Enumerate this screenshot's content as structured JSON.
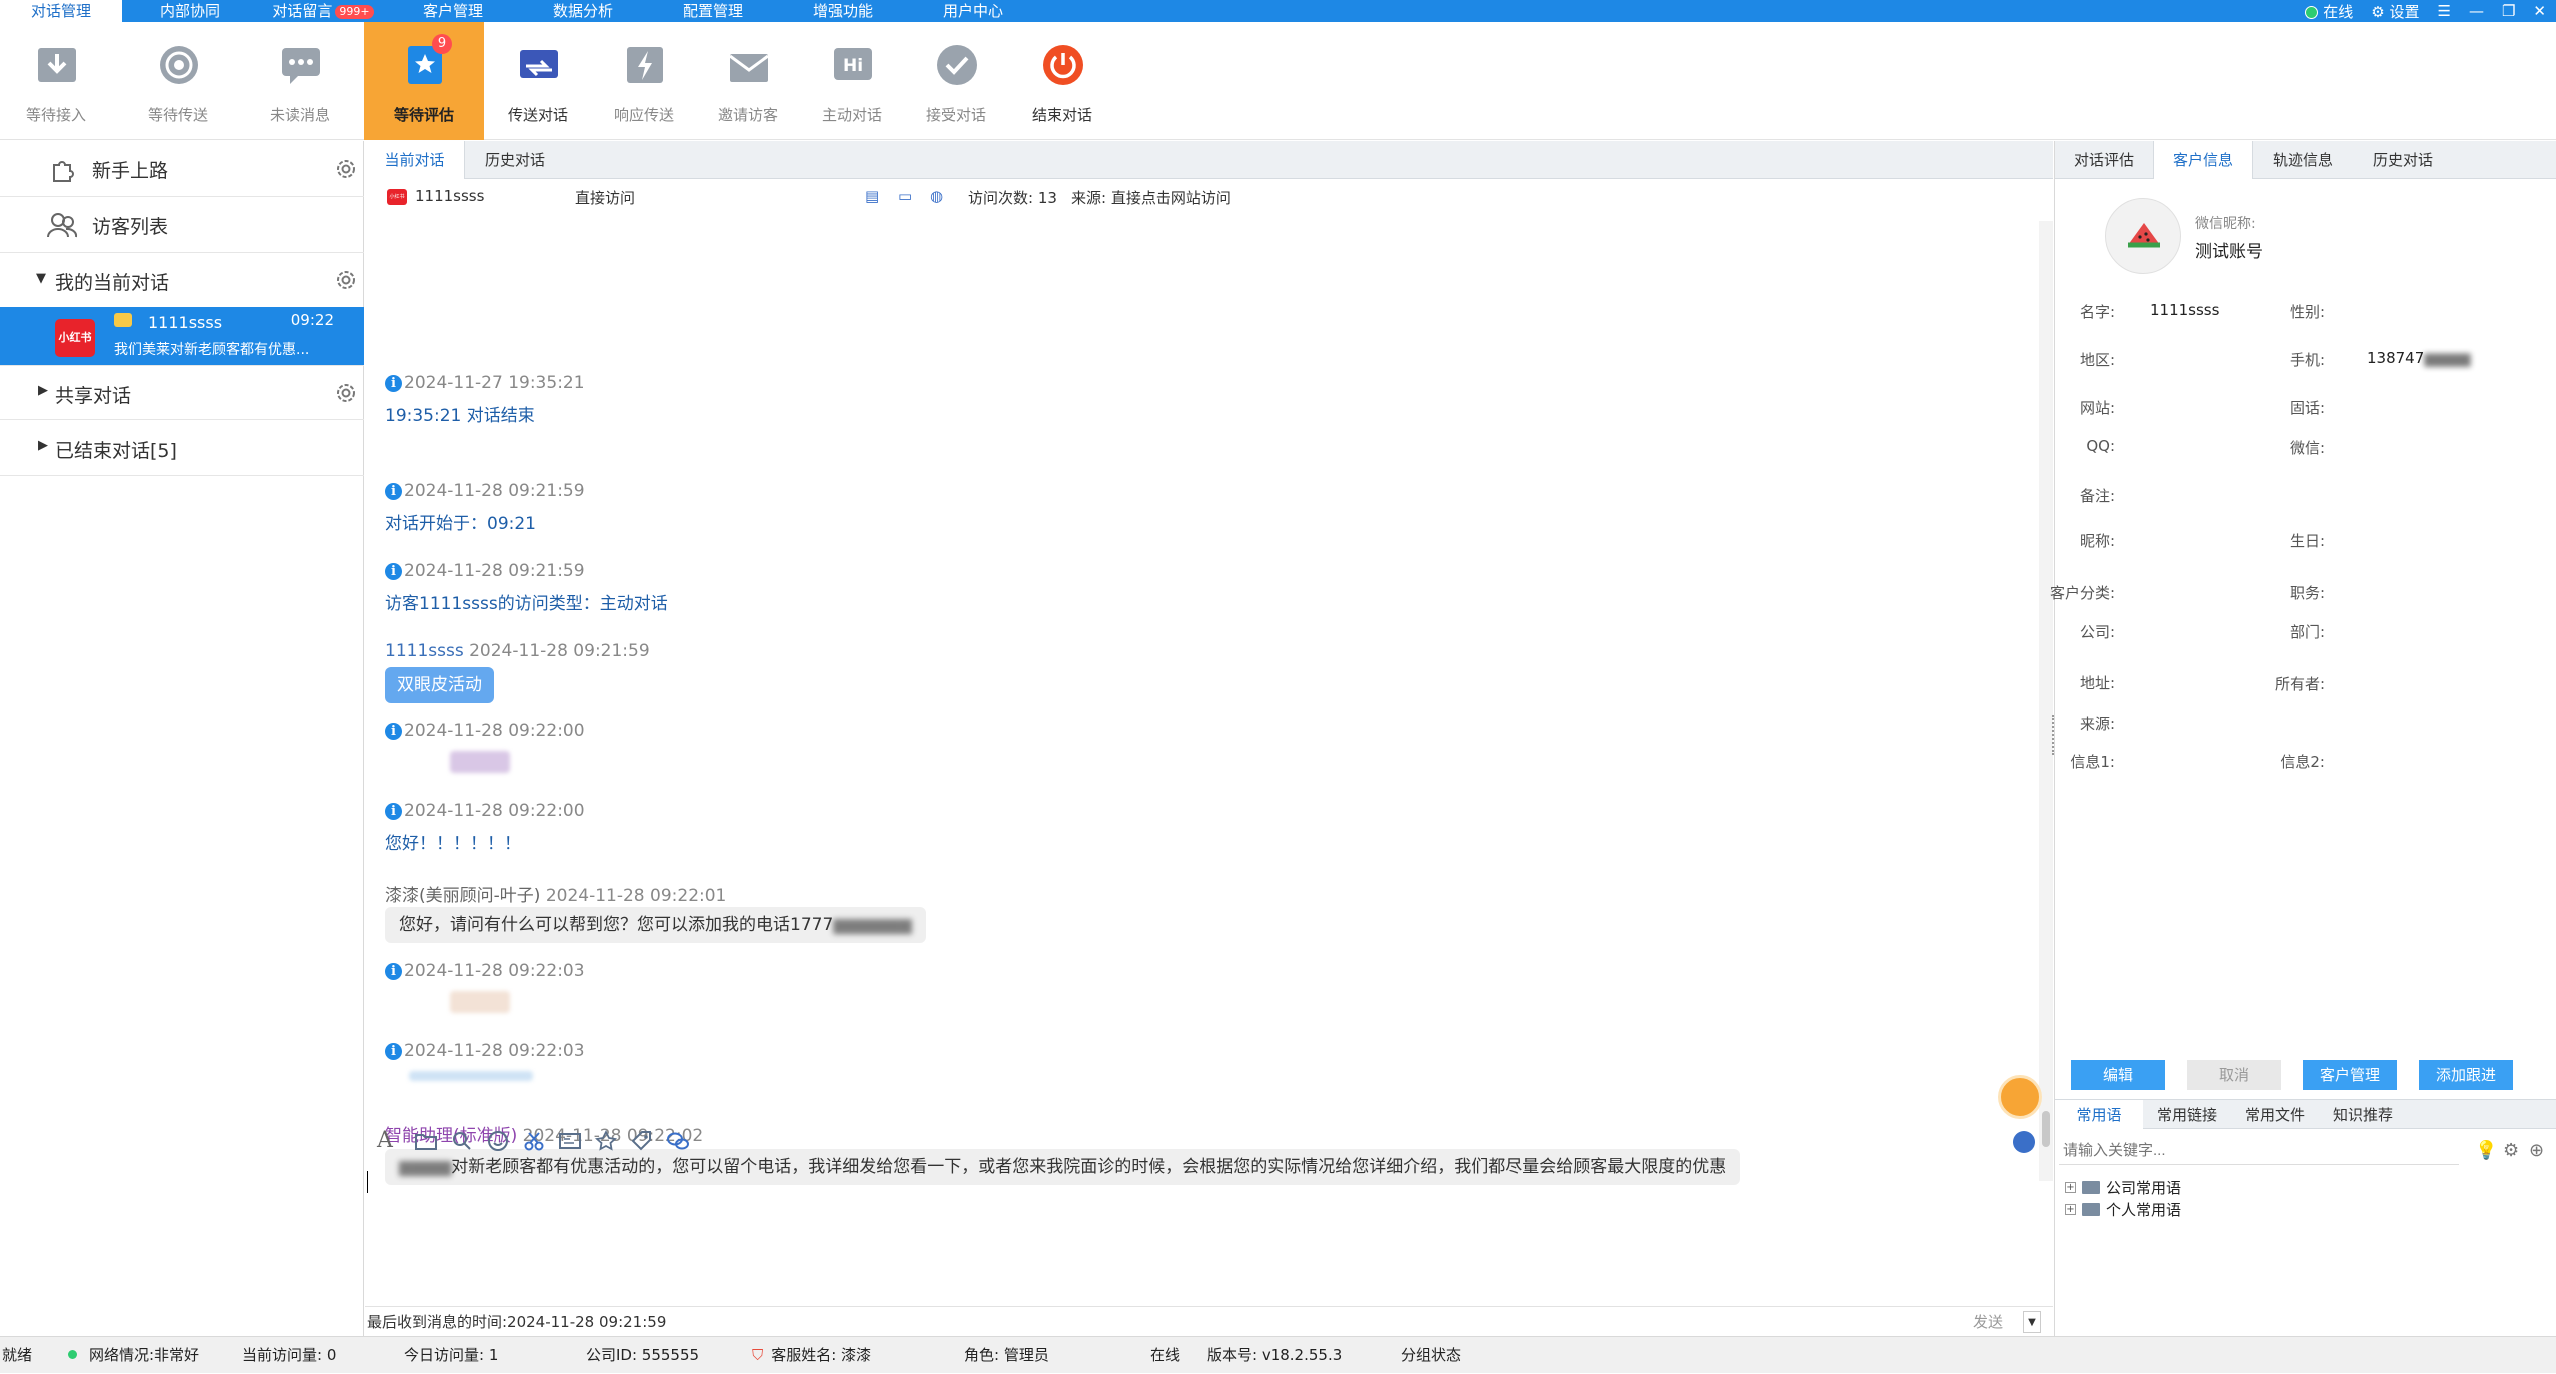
{
  "menu_tabs": [
    {
      "label": "对话管理",
      "active": true
    },
    {
      "label": "内部协同",
      "active": false
    },
    {
      "label": "对话留言",
      "badge": "999+",
      "active": false
    },
    {
      "label": "客户管理",
      "active": false
    },
    {
      "label": "数据分析",
      "active": false
    },
    {
      "label": "配置管理",
      "active": false
    },
    {
      "label": "增强功能",
      "active": false
    },
    {
      "label": "用户中心",
      "active": false
    }
  ],
  "top_right": {
    "status": "在线",
    "settings": "设置"
  },
  "toolbar": [
    {
      "label": "等待接入",
      "icon": "download-inbox-icon"
    },
    {
      "label": "等待传送",
      "icon": "broadcast-icon"
    },
    {
      "label": "未读消息",
      "icon": "chat-bubble-icon"
    },
    {
      "label": "等待评估",
      "icon": "star-badge-icon",
      "badge": "9",
      "active": true
    },
    {
      "label": "传送对话",
      "icon": "transfer-icon"
    },
    {
      "label": "响应传送",
      "icon": "lightning-icon"
    },
    {
      "label": "邀请访客",
      "icon": "envelope-icon"
    },
    {
      "label": "主动对话",
      "icon": "hi-icon"
    },
    {
      "label": "接受对话",
      "icon": "checkmark-icon"
    },
    {
      "label": "结束对话",
      "icon": "power-icon"
    }
  ],
  "sidebar": {
    "newbie": "新手上路",
    "visitor_list": "访客列表",
    "my_current": "我的当前对话",
    "conversation": {
      "source_tag": "小红书",
      "name": "1111ssss",
      "time": "09:22",
      "preview": "我们美莱对新老顾客都有优惠..."
    },
    "shared": "共享对话",
    "ended": "已结束对话[5]"
  },
  "center": {
    "tabs": [
      "当前对话",
      "历史对话"
    ],
    "visitor_source_tag": "小红书",
    "visitor_name": "1111ssss",
    "access_type": "直接访问",
    "visit_count": "访问次数: 13",
    "source": "来源: 直接点击网站访问",
    "messages": [
      {
        "time": "2024-11-27 19:35:21",
        "text": "19:35:21 对话结束"
      },
      {
        "time": "2024-11-28 09:21:59",
        "text": "对话开始于：09:21"
      },
      {
        "time": "2024-11-28 09:21:59",
        "text": "访客1111ssss的访问类型：主动对话"
      },
      {
        "sender": "1111ssss",
        "time": "2024-11-28 09:21:59",
        "bubble": "双眼皮活动"
      },
      {
        "time": "2024-11-28 09:22:00"
      },
      {
        "time": "2024-11-28 09:22:00",
        "text": "您好！！！！！！"
      },
      {
        "sender": "漆漆(美丽顾问-叶子)",
        "time": "2024-11-28 09:22:01",
        "bubble": "您好，请问有什么可以帮到您？您可以添加我的电话1777"
      },
      {
        "time": "2024-11-28 09:22:03"
      },
      {
        "time": "2024-11-28 09:22:03"
      },
      {
        "sender": "智能助理(标准版)",
        "time": "2024-11-28 09:22:02",
        "bubble": "对新老顾客都有优惠活动的，您可以留个电话，我详细发给您看一下，或者您来我院面诊的时候，会根据您的实际情况给您详细介绍，我们都尽量会给顾客最大限度的优惠"
      }
    ],
    "last_received": "最后收到消息的时间:2024-11-28 09:21:59",
    "send_label": "发送"
  },
  "right": {
    "tabs": [
      "对话评估",
      "客户信息",
      "轨迹信息",
      "历史对话"
    ],
    "wechat_nick_label": "微信昵称:",
    "wechat_nick": "测试账号",
    "fields": {
      "name_label": "名字:",
      "name": "1111ssss",
      "gender_label": "性别:",
      "region_label": "地区:",
      "mobile_label": "手机:",
      "mobile": "138747",
      "website_label": "网站:",
      "landline_label": "固话:",
      "qq_label": "QQ:",
      "wechat_label": "微信:",
      "remark_label": "备注:",
      "nickname_label": "昵称:",
      "birthday_label": "生日:",
      "category_label": "客户分类:",
      "position_label": "职务:",
      "company_label": "公司:",
      "department_label": "部门:",
      "address_label": "地址:",
      "owner_label": "所有者:",
      "source_label": "来源:",
      "info1_label": "信息1:",
      "info2_label": "信息2:"
    },
    "buttons": [
      "编辑",
      "取消",
      "客户管理",
      "添加跟进"
    ],
    "bottom_tabs": [
      "常用语",
      "常用链接",
      "常用文件",
      "知识推荐"
    ],
    "search_placeholder": "请输入关键字...",
    "tree": [
      "公司常用语",
      "个人常用语"
    ]
  },
  "statusbar": {
    "ready": "就绪",
    "network": "网络情况:非常好",
    "current_visits": "当前访问量: 0",
    "today_visits": "今日访问量: 1",
    "company_id": "公司ID: 555555",
    "agent_name": "客服姓名: 漆漆",
    "role": "角色: 管理员",
    "online": "在线",
    "version": "版本号: v18.2.55.3",
    "group_status": "分组状态"
  },
  "colors": {
    "accent": "#1e88e5",
    "active_tool": "#f7a535",
    "end_button": "#f04e23"
  }
}
